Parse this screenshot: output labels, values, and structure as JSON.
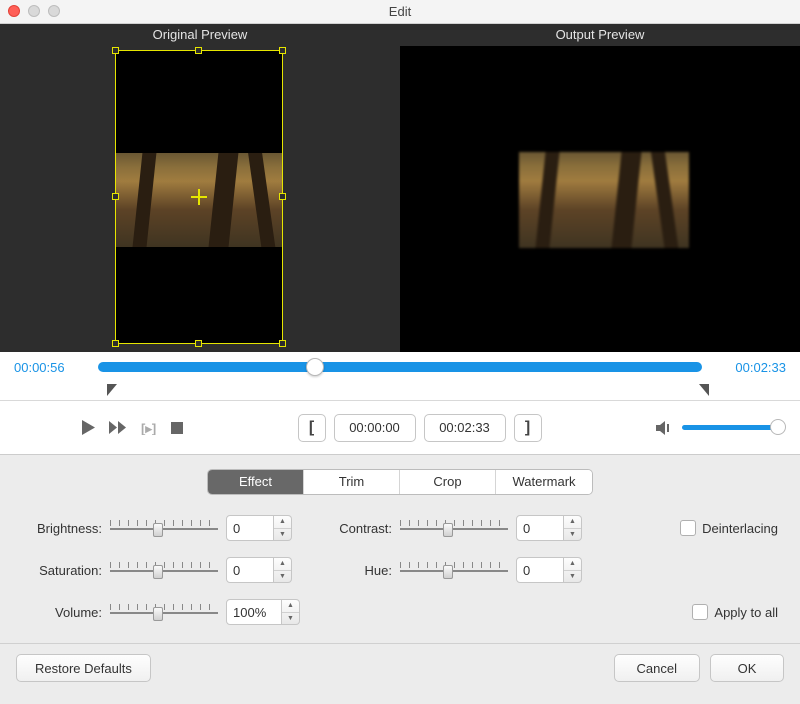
{
  "window": {
    "title": "Edit"
  },
  "previews": {
    "left_title": "Original Preview",
    "right_title": "Output Preview"
  },
  "timeline": {
    "start": "00:00:56",
    "end": "00:02:33",
    "playhead_pct": 36
  },
  "trim": {
    "in": "00:00:00",
    "out": "00:02:33"
  },
  "tabs": {
    "effect": "Effect",
    "trim": "Trim",
    "crop": "Crop",
    "watermark": "Watermark",
    "active": "effect"
  },
  "params": {
    "brightness": {
      "label": "Brightness:",
      "value": "0",
      "slider_pct": 40
    },
    "contrast": {
      "label": "Contrast:",
      "value": "0",
      "slider_pct": 40
    },
    "saturation": {
      "label": "Saturation:",
      "value": "0",
      "slider_pct": 40
    },
    "hue": {
      "label": "Hue:",
      "value": "0",
      "slider_pct": 40
    },
    "volume": {
      "label": "Volume:",
      "value": "100%",
      "slider_pct": 40
    }
  },
  "options": {
    "deinterlacing": "Deinterlacing",
    "apply_all": "Apply to all"
  },
  "footer": {
    "restore": "Restore Defaults",
    "cancel": "Cancel",
    "ok": "OK"
  }
}
